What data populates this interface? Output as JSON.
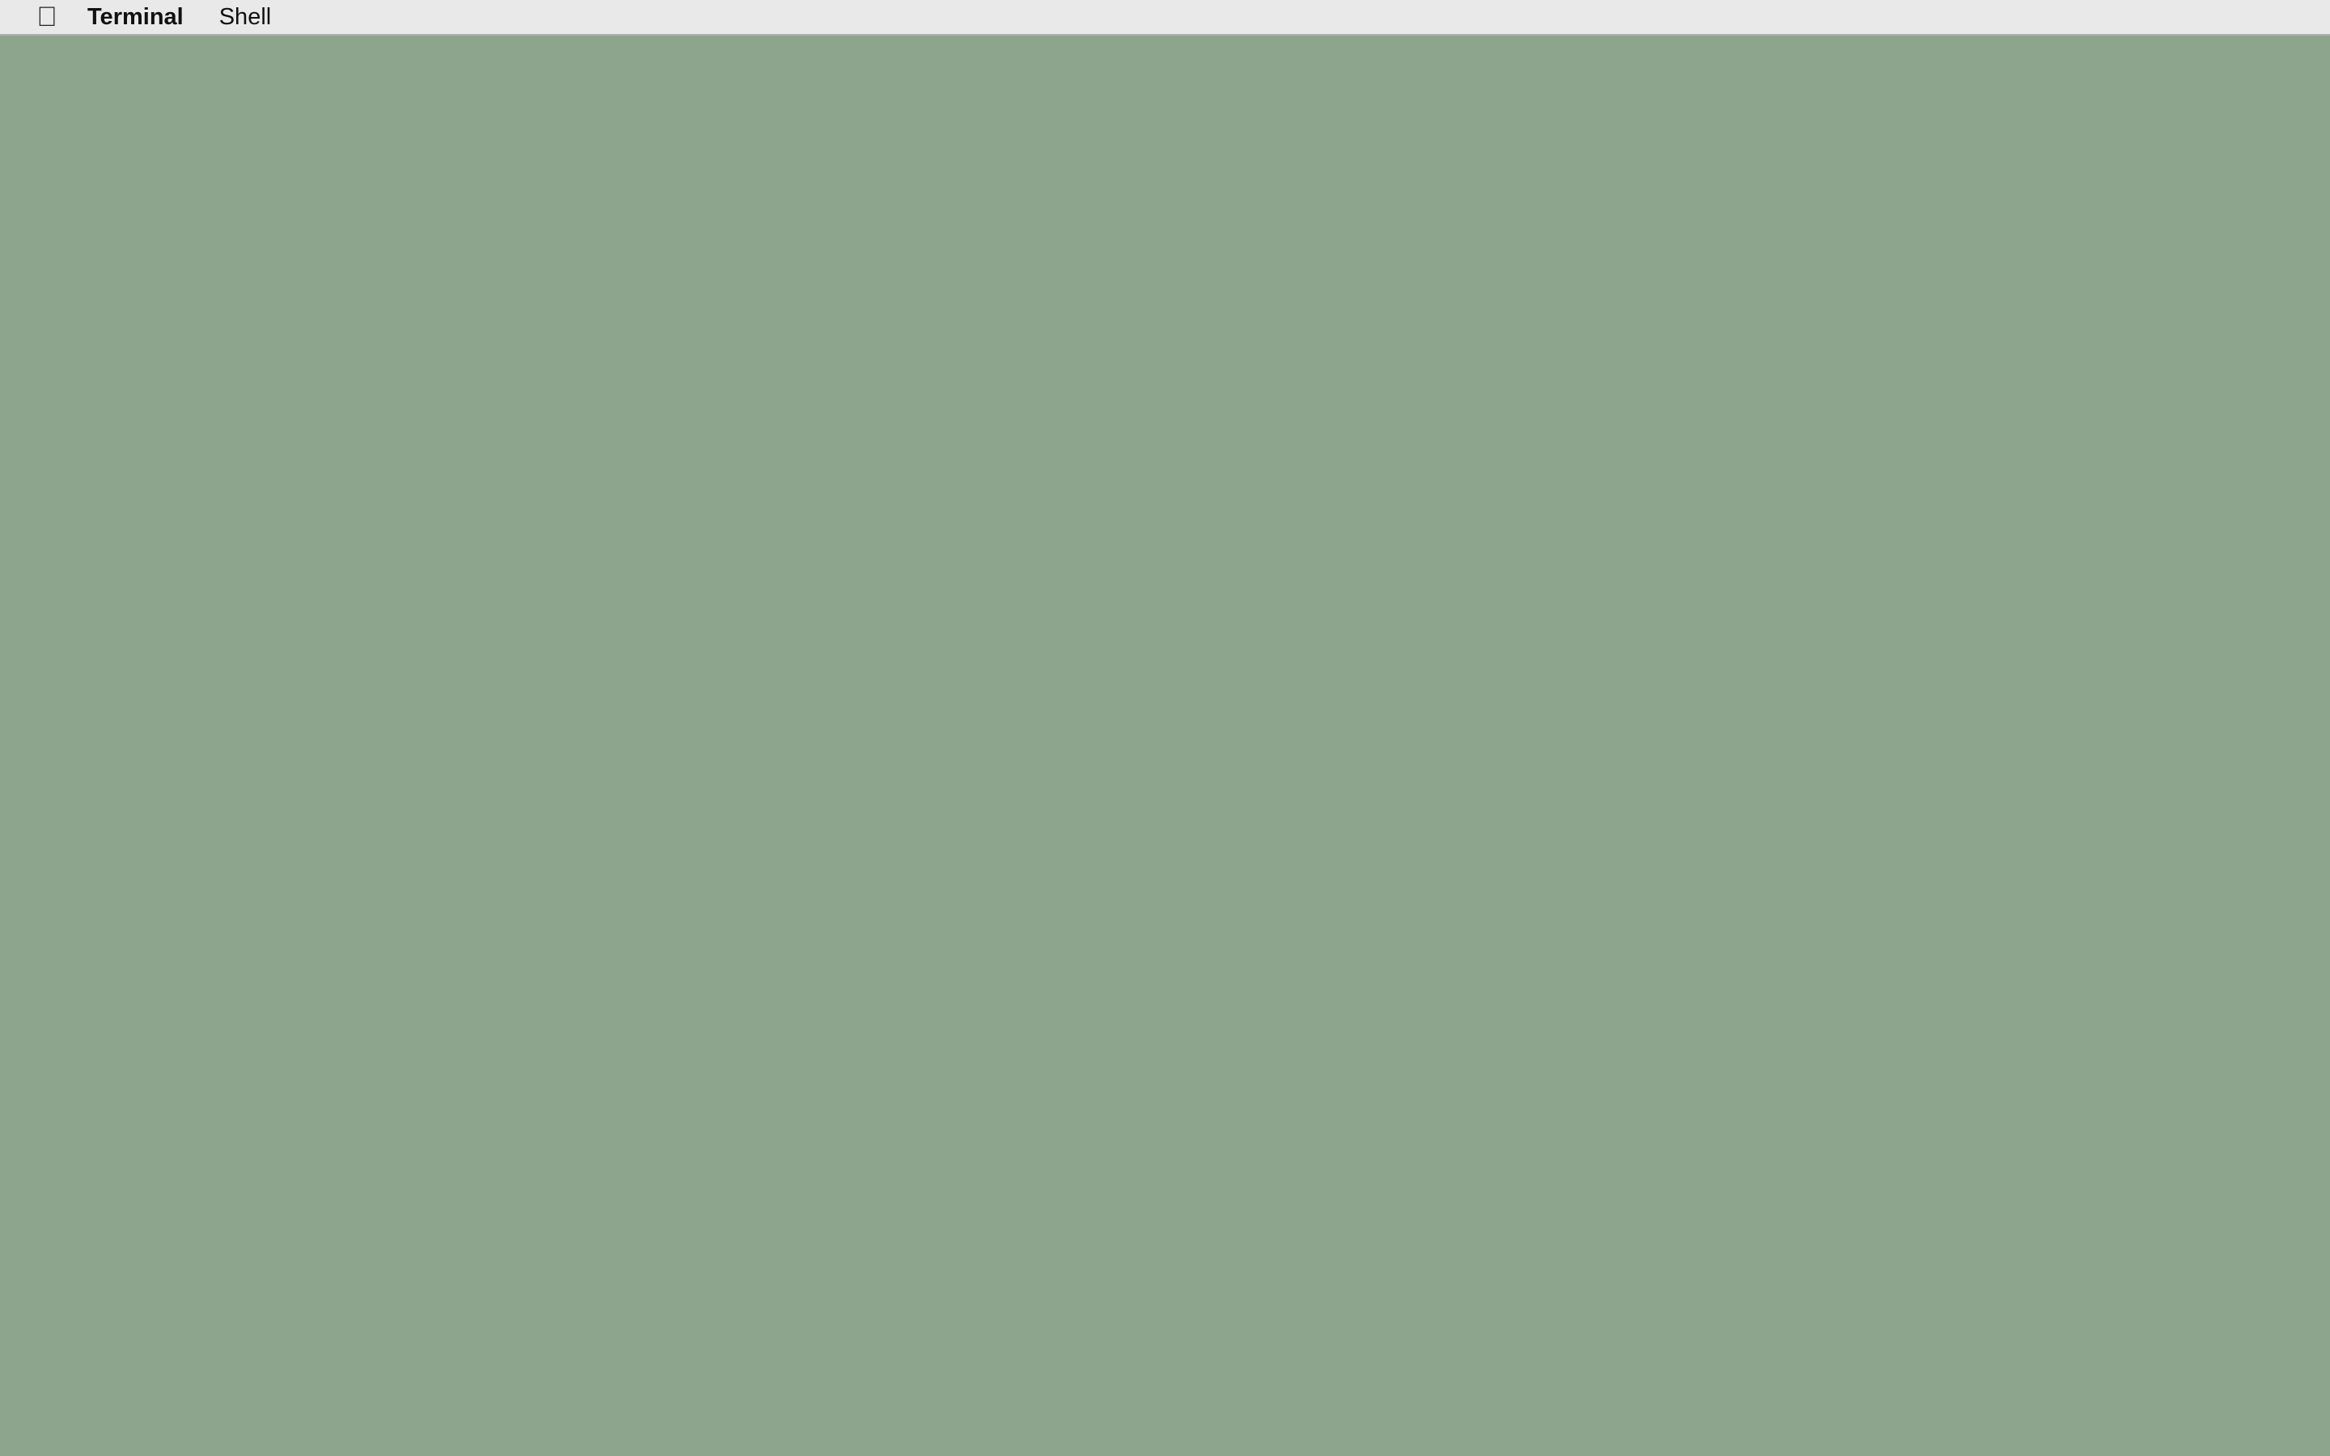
{
  "menu_bar": {
    "apple_icon": "apple-logo-icon",
    "app_name": "Terminal",
    "menus": [
      "Shell"
    ]
  },
  "colors": {
    "menu_bar": "#e9e9e9",
    "background": "#8da58d"
  }
}
